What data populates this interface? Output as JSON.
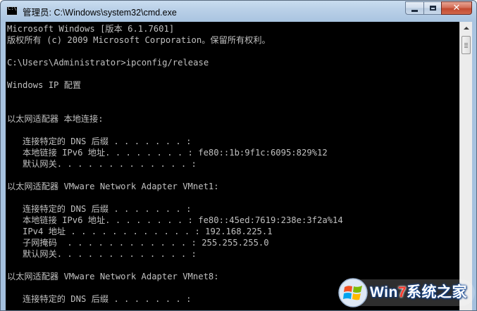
{
  "window": {
    "title": "管理员: C:\\Windows\\system32\\cmd.exe",
    "icon": "cmd-icon",
    "controls": {
      "minimize": "minimize-icon",
      "maximize": "maximize-icon",
      "close": "✕"
    }
  },
  "console": {
    "lines": [
      "Microsoft Windows [版本 6.1.7601]",
      "版权所有 (c) 2009 Microsoft Corporation。保留所有权利。",
      "",
      "C:\\Users\\Administrator>ipconfig/release",
      "",
      "Windows IP 配置",
      "",
      "",
      "以太网适配器 本地连接:",
      "",
      "   连接特定的 DNS 后缀 . . . . . . . :",
      "   本地链接 IPv6 地址. . . . . . . . : fe80::1b:9f1c:6095:829%12",
      "   默认网关. . . . . . . . . . . . . :",
      "",
      "以太网适配器 VMware Network Adapter VMnet1:",
      "",
      "   连接特定的 DNS 后缀 . . . . . . . :",
      "   本地链接 IPv6 地址. . . . . . . . : fe80::45ed:7619:238e:3f2a%14",
      "   IPv4 地址 . . . . . . . . . . . . : 192.168.225.1",
      "   子网掩码  . . . . . . . . . . . . : 255.255.255.0",
      "   默认网关. . . . . . . . . . . . . :",
      "",
      "以太网适配器 VMware Network Adapter VMnet8:",
      "",
      "   连接特定的 DNS 后缀 . . . . . . . :"
    ],
    "text_color": "#c0c0c0",
    "background": "#000000"
  },
  "watermark": {
    "prefix": "Win",
    "seven": "7",
    "suffix": "系统之家"
  }
}
